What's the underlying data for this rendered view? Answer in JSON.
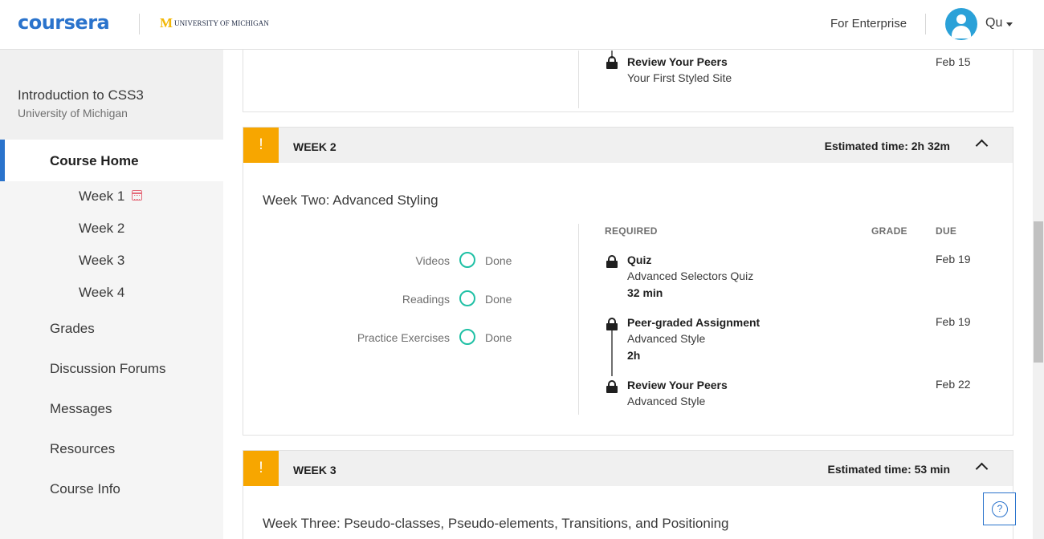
{
  "header": {
    "brand": "coursera",
    "partner": "UNIVERSITY OF MICHIGAN",
    "enterprise_link": "For Enterprise",
    "user_name": "Qu"
  },
  "sidebar": {
    "course_title": "Introduction to CSS3",
    "course_university": "University of Michigan",
    "home_label": "Course Home",
    "weeks": [
      "Week 1",
      "Week 2",
      "Week 3",
      "Week 4"
    ],
    "nav_items": [
      "Grades",
      "Discussion Forums",
      "Messages",
      "Resources",
      "Course Info"
    ]
  },
  "week1_tail": {
    "item": {
      "type": "Review Your Peers",
      "name": "Your First Styled Site",
      "due": "Feb 15"
    }
  },
  "week2": {
    "label": "WEEK 2",
    "estimated": "Estimated time: 2h 32m",
    "title": "Week Two: Advanced Styling",
    "columns": {
      "required": "REQUIRED",
      "grade": "GRADE",
      "due": "DUE"
    },
    "progress": [
      {
        "label": "Videos",
        "status": "Done"
      },
      {
        "label": "Readings",
        "status": "Done"
      },
      {
        "label": "Practice Exercises",
        "status": "Done"
      }
    ],
    "items": [
      {
        "type": "Quiz",
        "name": "Advanced Selectors Quiz",
        "time": "32 min",
        "due": "Feb 19"
      },
      {
        "type": "Peer-graded Assignment",
        "name": "Advanced Style",
        "time": "2h",
        "due": "Feb 19"
      },
      {
        "type": "Review Your Peers",
        "name": "Advanced Style",
        "due": "Feb 22"
      }
    ]
  },
  "week3": {
    "label": "WEEK 3",
    "estimated": "Estimated time: 53 min",
    "title": "Week Three: Pseudo-classes, Pseudo-elements, Transitions, and Positioning"
  },
  "icons": {
    "warning": "!",
    "help": "?"
  },
  "colors": {
    "brand": "#2a73cc",
    "warning": "#f7a600",
    "done": "#1fc0a5",
    "calendar": "#e56b7a"
  }
}
